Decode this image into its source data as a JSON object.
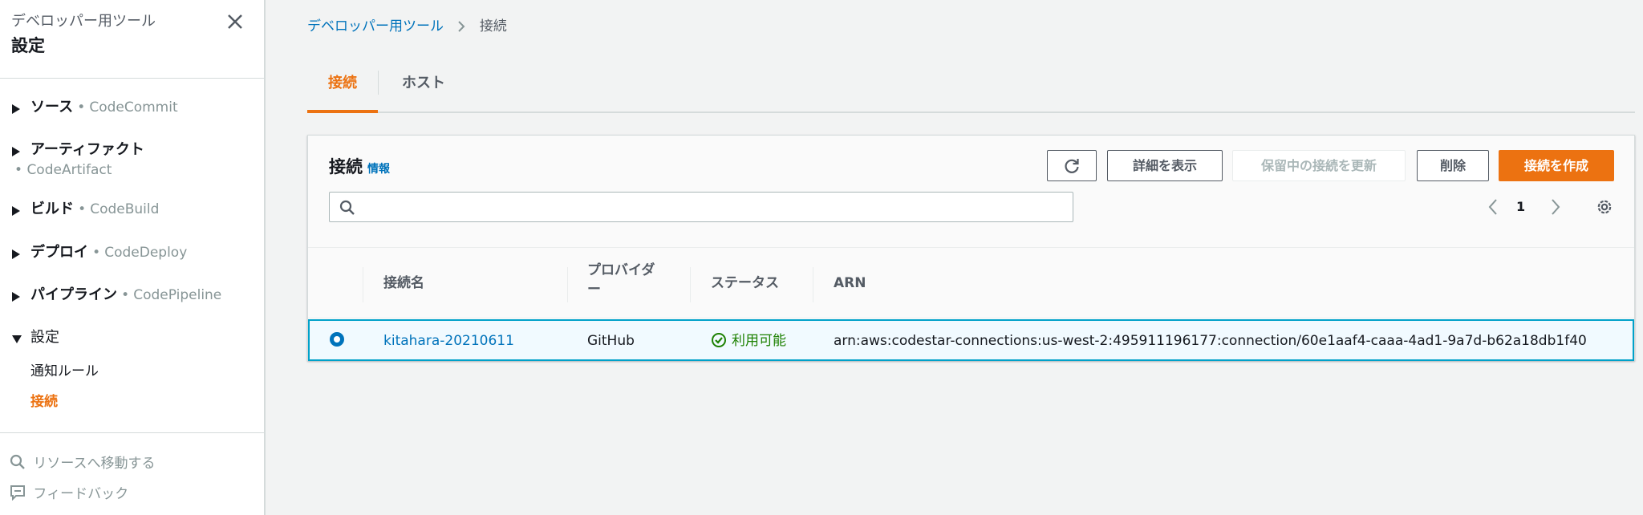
{
  "sidebar": {
    "subtitle": "デベロッパー用ツール",
    "title": "設定",
    "sections": [
      {
        "label": "ソース",
        "dot": "•",
        "service": "CodeCommit"
      },
      {
        "label": "アーティファクト",
        "dot": "•",
        "service": "CodeArtifact"
      },
      {
        "label": "ビルド",
        "dot": "•",
        "service": "CodeBuild"
      },
      {
        "label": "デプロイ",
        "dot": "•",
        "service": "CodeDeploy"
      },
      {
        "label": "パイプライン",
        "dot": "•",
        "service": "CodePipeline"
      },
      {
        "label": "設定"
      }
    ],
    "settings_links": [
      "通知ルール",
      "接続"
    ],
    "footer": [
      "リソースへ移動する",
      "フィードバック"
    ]
  },
  "breadcrumb": {
    "parent": "デベロッパー用ツール",
    "current": "接続"
  },
  "tabs": [
    "接続",
    "ホスト"
  ],
  "panel": {
    "title": "接続",
    "info": "情報",
    "buttons": {
      "view_details": "詳細を表示",
      "update_pending": "保留中の接続を更新",
      "delete": "削除",
      "create": "接続を作成"
    },
    "search": {
      "value": "",
      "placeholder": ""
    },
    "page": "1",
    "columns": [
      "接続名",
      "プロバイダー",
      "ステータス",
      "ARN"
    ],
    "rows": [
      {
        "name": "kitahara-20210611",
        "provider": "GitHub",
        "status": "利用可能",
        "arn": "arn:aws:codestar-connections:us-west-2:495911196177:connection/60e1aaf4-caaa-4ad1-9a7d-b62a18db1f40"
      }
    ]
  },
  "colors": {
    "accent": "#ec7211",
    "link": "#0073bb",
    "success": "#1d8102",
    "selected_border": "#00a1c9"
  },
  "icons": [
    "close-icon",
    "caret-right-icon",
    "caret-down-icon",
    "search-icon",
    "feedback-icon",
    "chevron-right-icon",
    "refresh-icon",
    "chevron-left-icon",
    "settings-icon",
    "status-success-icon"
  ]
}
